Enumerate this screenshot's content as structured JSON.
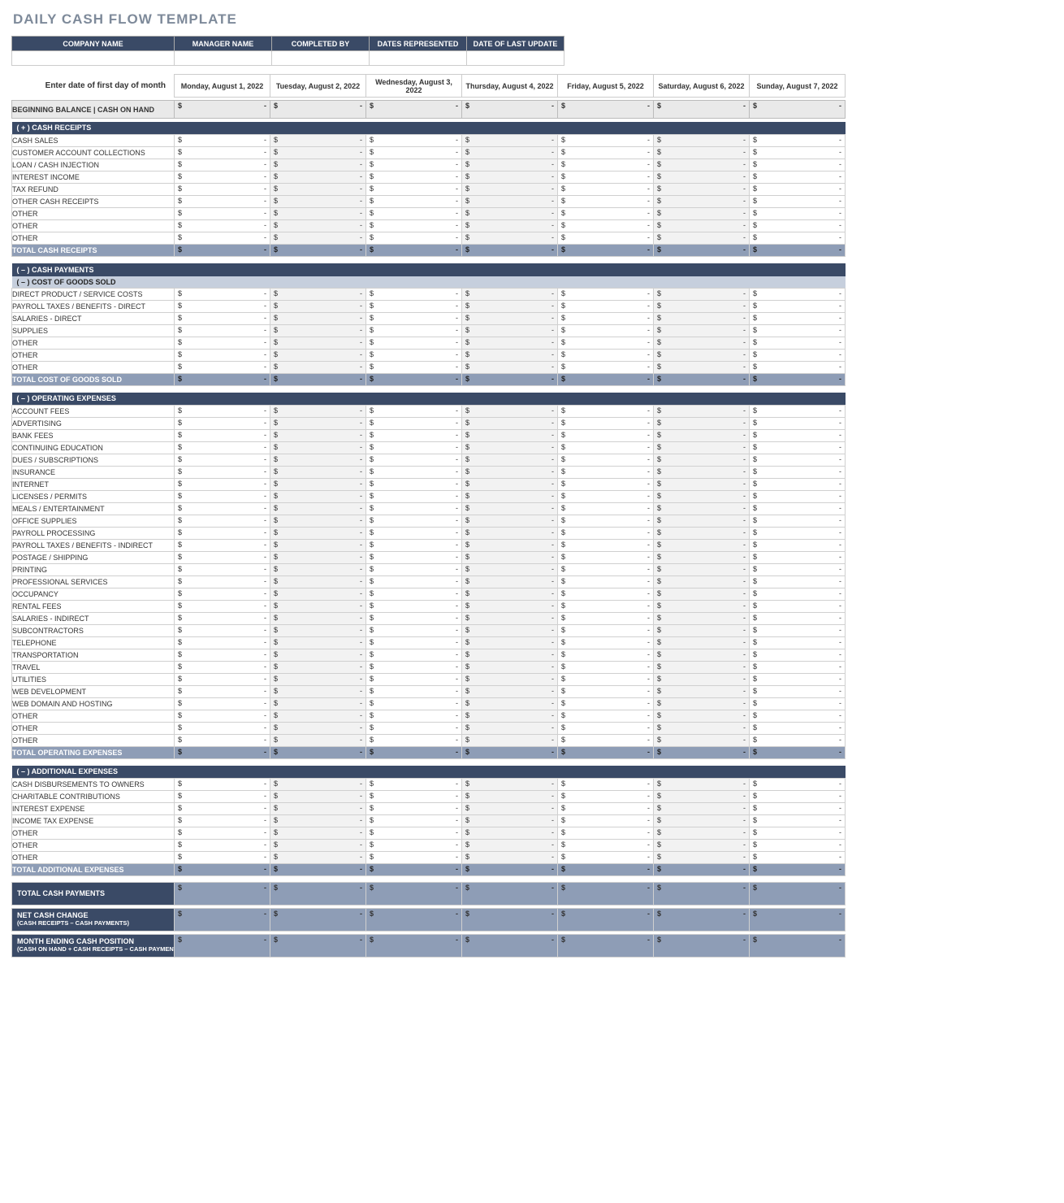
{
  "title": "DAILY CASH FLOW TEMPLATE",
  "info_headers": [
    "COMPANY NAME",
    "MANAGER NAME",
    "COMPLETED BY",
    "DATES REPRESENTED",
    "DATE OF LAST UPDATE"
  ],
  "date_prompt": "Enter date of first day of month",
  "dates": [
    "Monday, August 1, 2022",
    "Tuesday, August 2, 2022",
    "Wednesday, August 3, 2022",
    "Thursday, August 4, 2022",
    "Friday, August 5, 2022",
    "Saturday, August 6, 2022",
    "Sunday, August 7, 2022"
  ],
  "beginning_balance_label": "BEGINNING BALANCE  |  CASH ON HAND",
  "currency": "$",
  "dash": "-",
  "sections": {
    "cash_receipts": {
      "header": "( + )   CASH RECEIPTS",
      "rows": [
        "CASH SALES",
        "CUSTOMER ACCOUNT COLLECTIONS",
        "LOAN / CASH INJECTION",
        "INTEREST INCOME",
        "TAX REFUND",
        "OTHER CASH RECEIPTS",
        "OTHER",
        "OTHER",
        "OTHER"
      ],
      "total": "TOTAL CASH RECEIPTS"
    },
    "cash_payments_header": "( – )   CASH PAYMENTS",
    "cogs": {
      "header": "( – )   COST OF GOODS SOLD",
      "rows": [
        "DIRECT PRODUCT / SERVICE COSTS",
        "PAYROLL TAXES / BENEFITS - DIRECT",
        "SALARIES - DIRECT",
        "SUPPLIES",
        "OTHER",
        "OTHER",
        "OTHER"
      ],
      "total": "TOTAL COST OF GOODS SOLD"
    },
    "opex": {
      "header": "( – )   OPERATING EXPENSES",
      "rows": [
        "ACCOUNT FEES",
        "ADVERTISING",
        "BANK FEES",
        "CONTINUING EDUCATION",
        "DUES / SUBSCRIPTIONS",
        "INSURANCE",
        "INTERNET",
        "LICENSES / PERMITS",
        "MEALS / ENTERTAINMENT",
        "OFFICE SUPPLIES",
        "PAYROLL PROCESSING",
        "PAYROLL TAXES / BENEFITS - INDIRECT",
        "POSTAGE / SHIPPING",
        "PRINTING",
        "PROFESSIONAL SERVICES",
        "OCCUPANCY",
        "RENTAL FEES",
        "SALARIES - INDIRECT",
        "SUBCONTRACTORS",
        "TELEPHONE",
        "TRANSPORTATION",
        "TRAVEL",
        "UTILITIES",
        "WEB DEVELOPMENT",
        "WEB DOMAIN AND HOSTING",
        "OTHER",
        "OTHER",
        "OTHER"
      ],
      "total": "TOTAL OPERATING EXPENSES"
    },
    "addl": {
      "header": "( – )   ADDITIONAL EXPENSES",
      "rows": [
        "CASH DISBURSEMENTS TO OWNERS",
        "CHARITABLE CONTRIBUTIONS",
        "INTEREST EXPENSE",
        "INCOME TAX EXPENSE",
        "OTHER",
        "OTHER",
        "OTHER"
      ],
      "total": "TOTAL ADDITIONAL EXPENSES"
    }
  },
  "summaries": {
    "total_cash_payments": "TOTAL CASH PAYMENTS",
    "net_cash_change": "NET CASH CHANGE",
    "net_cash_change_sub": "(CASH RECEIPTS – CASH PAYMENTS)",
    "ending_position": "MONTH ENDING CASH POSITION",
    "ending_position_sub": "(CASH ON HAND + CASH RECEIPTS – CASH PAYMENTS)"
  }
}
